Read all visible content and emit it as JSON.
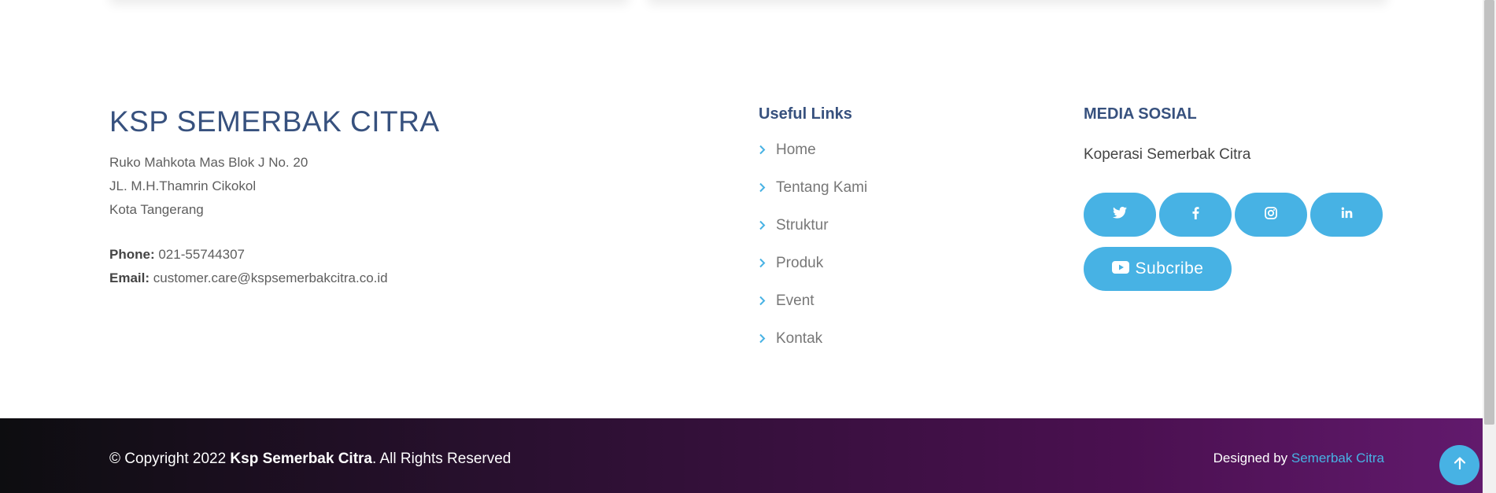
{
  "brand": {
    "name": "KSP SEMERBAK CITRA",
    "address_lines": [
      "Ruko Mahkota Mas Blok J No. 20",
      "JL. M.H.Thamrin Cikokol",
      "Kota Tangerang"
    ],
    "phone_label": "Phone:",
    "phone_value": "021-55744307",
    "email_label": "Email:",
    "email_value": "customer.care@kspsemerbakcitra.co.id"
  },
  "useful_links": {
    "title": "Useful Links",
    "items": [
      "Home",
      "Tentang Kami",
      "Struktur",
      "Produk",
      "Event",
      "Kontak"
    ]
  },
  "social": {
    "title": "MEDIA SOSIAL",
    "text": "Koperasi Semerbak Citra",
    "buttons": [
      {
        "icon": "twitter-icon"
      },
      {
        "icon": "facebook-icon"
      },
      {
        "icon": "instagram-icon"
      },
      {
        "icon": "linkedin-icon"
      }
    ],
    "subscribe_icon": "youtube-icon",
    "subscribe_label": "Subcribe"
  },
  "bottom": {
    "copyright_prefix": "© Copyright 2022 ",
    "copyright_brand": "Ksp Semerbak Citra",
    "copyright_suffix": ". All Rights Reserved",
    "designed_prefix": "Designed by ",
    "designed_link": "Semerbak Citra",
    "back_to_top_icon": "arrow-up-icon"
  },
  "colors": {
    "accent": "#47b2e4",
    "heading": "#37517e",
    "bottom_gradient_start": "#0d0d10",
    "bottom_gradient_end": "#631a6e"
  }
}
